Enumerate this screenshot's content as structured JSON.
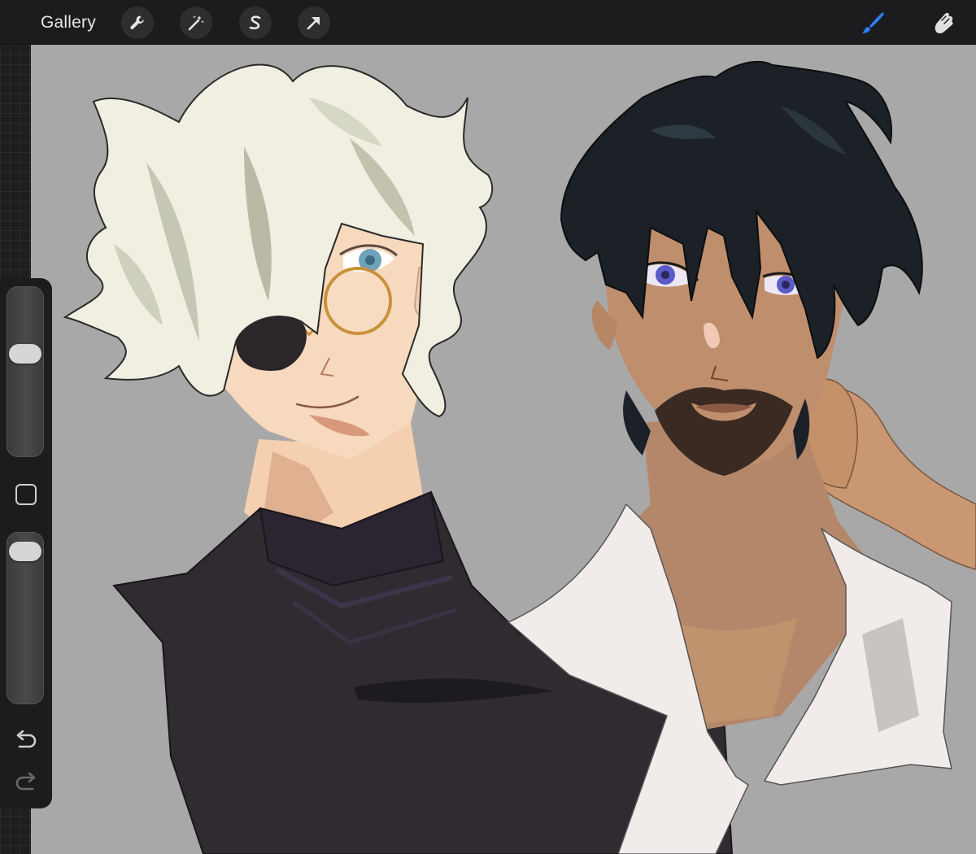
{
  "app": {
    "gallery_label": "Gallery"
  },
  "toolbar": {
    "left_tools": [
      {
        "name": "actions",
        "icon": "wrench-icon"
      },
      {
        "name": "adjustments",
        "icon": "magic-wand-icon"
      },
      {
        "name": "selection",
        "icon": "selection-s-icon"
      },
      {
        "name": "transform",
        "icon": "arrow-cursor-icon"
      }
    ],
    "right_tools": [
      {
        "name": "brush",
        "icon": "brush-icon",
        "active": true,
        "color": "#2f7cf6"
      },
      {
        "name": "smudge",
        "icon": "smudge-finger-icon",
        "active": false,
        "color": "#e0e0e0"
      }
    ]
  },
  "sidebar": {
    "brush_size_level": 0.62,
    "opacity_level": 0.95,
    "modify_button_icon": "square-icon",
    "undo_icon": "undo-icon",
    "redo_icon": "redo-icon"
  },
  "canvas": {
    "background_color": "#a8a8a8"
  }
}
